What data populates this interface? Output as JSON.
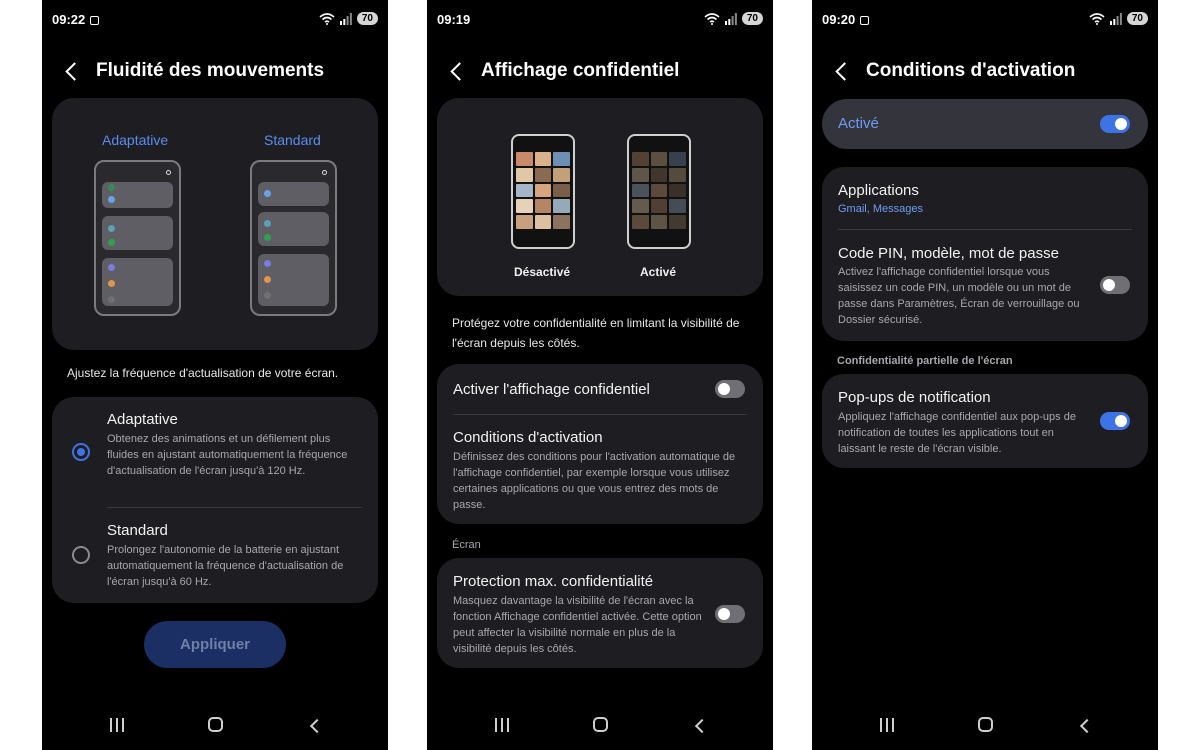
{
  "colors": {
    "accent": "#3e73e6",
    "card": "#1e1e22",
    "background": "#000000"
  },
  "screen1": {
    "time": "09:22",
    "battery": "70",
    "title": "Fluidité des mouvements",
    "preview": {
      "label_adaptive": "Adaptative",
      "label_standard": "Standard"
    },
    "description": "Ajustez la fréquence d'actualisation de votre écran.",
    "options": [
      {
        "title": "Adaptative",
        "desc": "Obtenez des animations et un défilement plus fluides en ajustant automatiquement la fréquence d'actualisation de l'écran jusqu'à 120 Hz.",
        "selected": true
      },
      {
        "title": "Standard",
        "desc": "Prolongez l'autonomie de la batterie en ajustant automatiquement la fréquence d'actualisation de l'écran jusqu'à 60 Hz.",
        "selected": false
      }
    ],
    "apply_label": "Appliquer"
  },
  "screen2": {
    "time": "09:19",
    "battery": "70",
    "title": "Affichage confidentiel",
    "preview": {
      "label_off": "Désactivé",
      "label_on": "Activé"
    },
    "description": "Protégez votre confidentialité en limitant la visibilité de l'écran depuis les côtés.",
    "toggle_label": "Activer l'affichage confidentiel",
    "toggle_on": false,
    "conditions_title": "Conditions d'activation",
    "conditions_desc": "Définissez des conditions pour l'activation automatique de l'affichage confidentiel, par exemple lorsque vous utilisez certaines applications ou que vous entrez des mots de passe.",
    "section_label": "Écran",
    "max_title": "Protection max. confidentialité",
    "max_desc": "Masquez davantage la visibilité de l'écran avec la fonction Affichage confidentiel activée. Cette option peut affecter la visibilité normale en plus de la visibilité depuis les côtés.",
    "max_on": false
  },
  "screen3": {
    "time": "09:20",
    "battery": "70",
    "title": "Conditions d'activation",
    "master_label": "Activé",
    "master_on": true,
    "apps_title": "Applications",
    "apps_value": "Gmail, Messages",
    "pin_title": "Code PIN, modèle, mot de passe",
    "pin_desc": "Activez l'affichage confidentiel lorsque vous saisissez un code PIN, un modèle ou un mot de passe dans Paramètres, Écran de verrouillage ou Dossier sécurisé.",
    "pin_on": false,
    "section_label": "Confidentialité partielle de l'écran",
    "popup_title": "Pop-ups de notification",
    "popup_desc": "Appliquez l'affichage confidentiel aux pop-ups de notification de toutes les applications tout en laissant le reste de l'écran visible.",
    "popup_on": true
  },
  "icons": [
    "wifi-icon",
    "signal-icon",
    "battery-icon",
    "back-icon",
    "recents-icon",
    "home-icon",
    "nav-back-icon",
    "search-icon",
    "screen-record-icon"
  ]
}
